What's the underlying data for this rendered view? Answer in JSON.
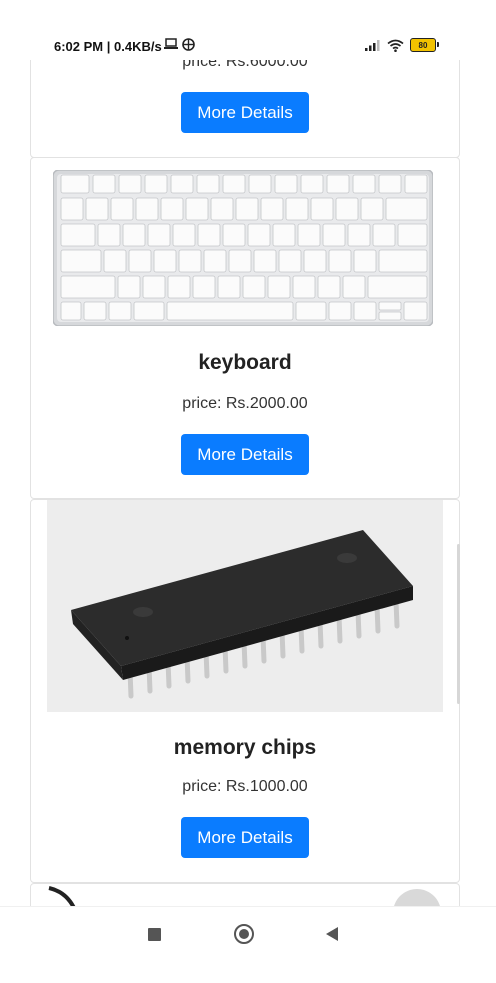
{
  "status_bar": {
    "time": "6:02 PM | 0.4KB/s",
    "battery": "80"
  },
  "products": [
    {
      "title": "",
      "price": "price: Rs.6000.00",
      "button": "More Details",
      "image": "monitor-image"
    },
    {
      "title": "keyboard",
      "price": "price: Rs.2000.00",
      "button": "More Details",
      "image": "keyboard-image"
    },
    {
      "title": "memory chips",
      "price": "price: Rs.1000.00",
      "button": "More Details",
      "image": "memory-chip-image"
    }
  ],
  "colors": {
    "button_bg": "#0a7cff",
    "button_text": "#ffffff",
    "card_border": "#e2e2e2"
  },
  "nav_icons": [
    "recent-apps-icon",
    "home-icon",
    "back-icon"
  ]
}
